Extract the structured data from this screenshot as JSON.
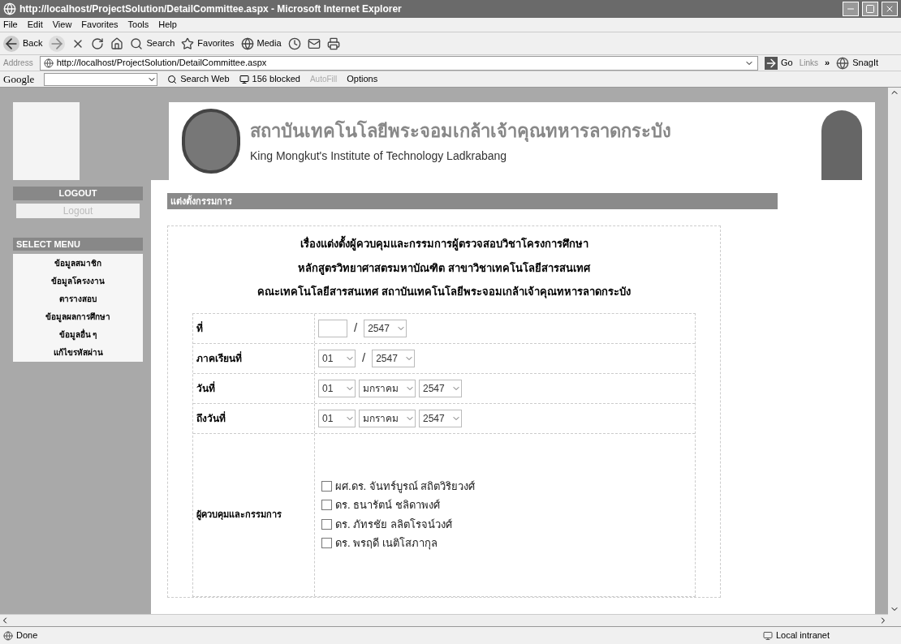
{
  "window": {
    "title": "http://localhost/ProjectSolution/DetailCommittee.aspx - Microsoft Internet Explorer"
  },
  "menu": [
    "File",
    "Edit",
    "View",
    "Favorites",
    "Tools",
    "Help"
  ],
  "toolbar": {
    "back": "Back",
    "search": "Search",
    "favorites": "Favorites",
    "media": "Media"
  },
  "address_bar": {
    "label": "Address",
    "url": "http://localhost/ProjectSolution/DetailCommittee.aspx",
    "go": "Go",
    "links": "Links",
    "chevron": "»",
    "snagit": "SnagIt"
  },
  "google_bar": {
    "logo": "Google",
    "search_web": "Search Web",
    "blocked": "156 blocked",
    "autofill": {
      "label": "AutoFill",
      "disabled": true
    },
    "options": "Options"
  },
  "banner": {
    "title_th": "สถาบันเทคโนโลยีพระจอมเกล้าเจ้าคุณทหารลาดกระบัง",
    "title_en": "King Mongkut's Institute of Technology Ladkrabang"
  },
  "sidebar": {
    "logout_heading": "LOGOUT",
    "logout_button": "Logout",
    "menu_heading": "SELECT MENU",
    "items": [
      "ข้อมูลสมาชิก",
      "ข้อมูลโครงงาน",
      "ตารางสอบ",
      "ข้อมูลผลการศึกษา",
      "ข้อมูลอื่น ๆ",
      "แก้ไขรหัสผ่าน"
    ]
  },
  "panel": {
    "title": "แต่งตั้งกรรมการ",
    "headings": [
      "เรื่องแต่งตั้งผู้ควบคุมและกรรมการผู้ตรวจสอบวิชาโครงการศึกษา",
      "หลักสูตรวิทยาศาสตรมหาบัณฑิต สาขาวิชาเทคโนโลยีสารสนเทศ",
      "คณะเทคโนโลยีสารสนเทศ สถาบันเทคโนโลยีพระจอมเกล้าเจ้าคุณทหารลาดกระบัง"
    ],
    "rows": [
      {
        "label": "ที่",
        "fields": [
          {
            "kind": "input"
          },
          {
            "kind": "separator",
            "value": "/"
          },
          {
            "kind": "select",
            "value": "2547"
          }
        ]
      },
      {
        "label": "ภาคเรียนที่",
        "fields": [
          {
            "kind": "select",
            "value": "01"
          },
          {
            "kind": "separator",
            "value": "/"
          },
          {
            "kind": "select",
            "value": "2547"
          }
        ]
      },
      {
        "label": "วันที่",
        "fields": [
          {
            "kind": "select",
            "value": "01"
          },
          {
            "kind": "select",
            "value": "มกราคม"
          },
          {
            "kind": "select",
            "value": "2547"
          }
        ]
      },
      {
        "label": "ถึงวันที่",
        "fields": [
          {
            "kind": "select",
            "value": "01"
          },
          {
            "kind": "select",
            "value": "มกราคม"
          },
          {
            "kind": "select",
            "value": "2547"
          }
        ]
      }
    ],
    "committee": {
      "label": "ผู้ควบคุมและกรรมการ",
      "members": [
        {
          "name": "ผศ.ดร. จันทร์บูรณ์ สถิตวิริยวงศ์",
          "checked": false
        },
        {
          "name": "ดร. ธนารัตน์ ชลิดาพงศ์",
          "checked": false
        },
        {
          "name": "ดร. ภัทรชัย ลลิตโรจน์วงศ์",
          "checked": false
        },
        {
          "name": "ดร. พรฤดี เนติโสภากุล",
          "checked": false
        }
      ]
    }
  },
  "status_bar": {
    "text": "Done",
    "zone": "Local intranet"
  }
}
